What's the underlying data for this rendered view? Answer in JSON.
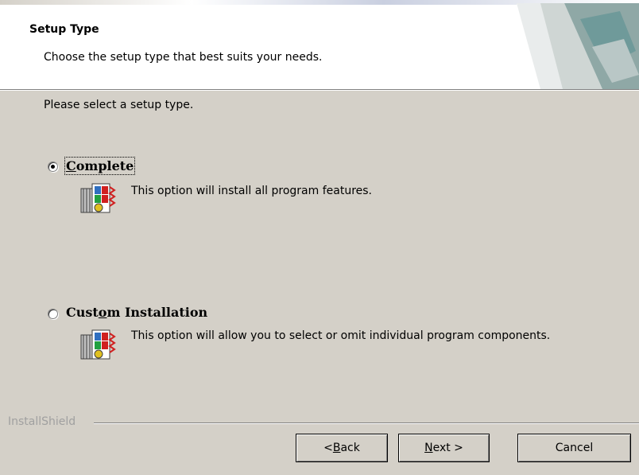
{
  "header": {
    "title": "Setup Type",
    "subtitle": "Choose the setup type that best suits your needs."
  },
  "prompt": "Please select a setup type.",
  "options": [
    {
      "label_pre": "",
      "label_mnemonic": "C",
      "label_post": "omplete",
      "description": "This option will install all program features.",
      "checked": true
    },
    {
      "label_pre": "Cust",
      "label_mnemonic": "o",
      "label_post": "m Installation",
      "description": "This option will allow you to select or omit individual program components.",
      "checked": false
    }
  ],
  "brand": "InstallShield",
  "buttons": {
    "back_pre": "< ",
    "back_mnemonic": "B",
    "back_post": "ack",
    "next_mnemonic": "N",
    "next_post": "ext >",
    "cancel": "Cancel"
  },
  "icons": {
    "header": "installer-banner-icon",
    "option": "setup-type-icon"
  }
}
